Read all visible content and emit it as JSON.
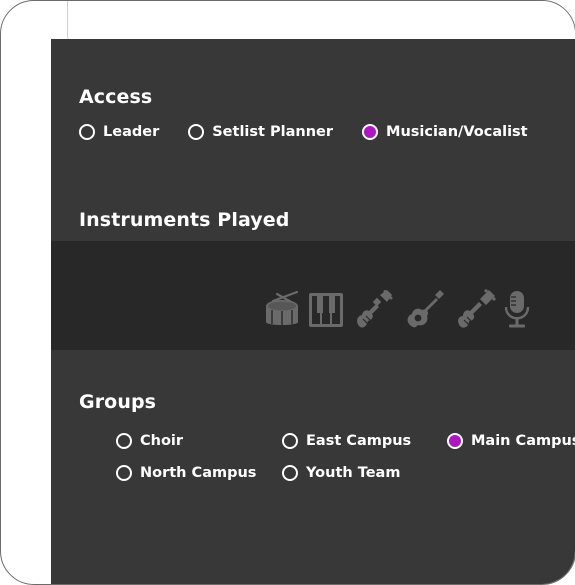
{
  "access": {
    "title": "Access",
    "options": [
      {
        "label": "Leader",
        "selected": false
      },
      {
        "label": "Setlist Planner",
        "selected": false
      },
      {
        "label": "Musician/Vocalist",
        "selected": true
      }
    ]
  },
  "instruments": {
    "title": "Instruments Played",
    "items": [
      {
        "name": "drum-icon"
      },
      {
        "name": "piano-icon"
      },
      {
        "name": "electric-guitar-icon"
      },
      {
        "name": "acoustic-guitar-icon"
      },
      {
        "name": "bass-guitar-icon"
      },
      {
        "name": "microphone-icon"
      }
    ]
  },
  "groups": {
    "title": "Groups",
    "options": [
      {
        "label": "Choir",
        "selected": false
      },
      {
        "label": "East Campus",
        "selected": false
      },
      {
        "label": "Main Campus",
        "selected": true
      },
      {
        "label": "North Campus",
        "selected": false
      },
      {
        "label": "Youth Team",
        "selected": false
      }
    ]
  },
  "colors": {
    "panel": "#383838",
    "band": "#282828",
    "accent": "#b015c4",
    "icon": "#6a6a6a"
  }
}
